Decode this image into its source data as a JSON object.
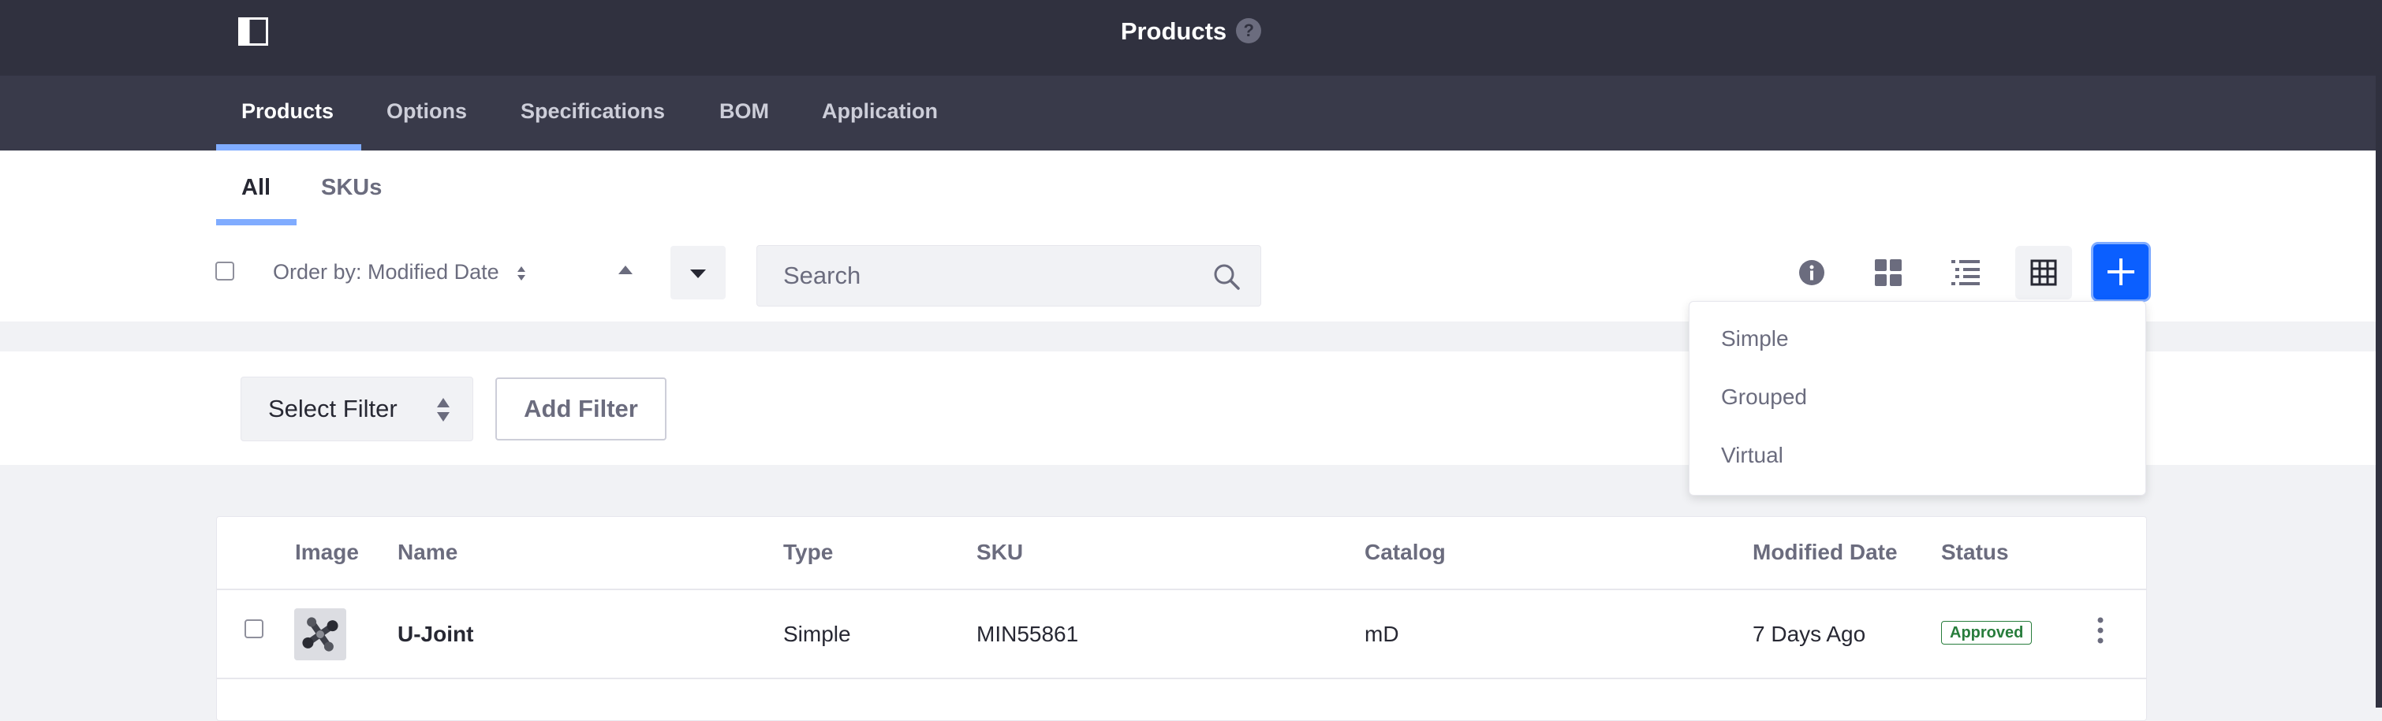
{
  "header": {
    "title": "Products",
    "help_icon": "help-circle-icon",
    "help_glyph": "?"
  },
  "nav": {
    "tabs": [
      {
        "label": "Products",
        "active": true
      },
      {
        "label": "Options"
      },
      {
        "label": "Specifications"
      },
      {
        "label": "BOM"
      },
      {
        "label": "Application"
      }
    ]
  },
  "subnav": {
    "tabs": [
      {
        "label": "All",
        "active": true
      },
      {
        "label": "SKUs"
      }
    ]
  },
  "toolbar": {
    "order_by_label": "Order by: Modified Date",
    "search_placeholder": "Search",
    "icons": [
      "info-icon",
      "cards-view-icon",
      "list-view-icon",
      "table-view-icon",
      "plus-icon"
    ]
  },
  "filter": {
    "select_label": "Select Filter",
    "add_label": "Add Filter"
  },
  "table": {
    "headers": [
      "Image",
      "Name",
      "Type",
      "SKU",
      "Catalog",
      "Modified Date",
      "Status"
    ],
    "rows": [
      {
        "name": "U-Joint",
        "type": "Simple",
        "sku": "MIN55861",
        "catalog": "mD",
        "modified": "7 Days Ago",
        "status": "Approved"
      }
    ]
  },
  "add_menu": {
    "items": [
      "Simple",
      "Grouped",
      "Virtual"
    ]
  },
  "colors": {
    "primary": "#0b5fff",
    "header_bg": "#30313f",
    "nav_bg": "#393a4a",
    "accent_underline": "#80acff",
    "approved": "#287d3c"
  }
}
